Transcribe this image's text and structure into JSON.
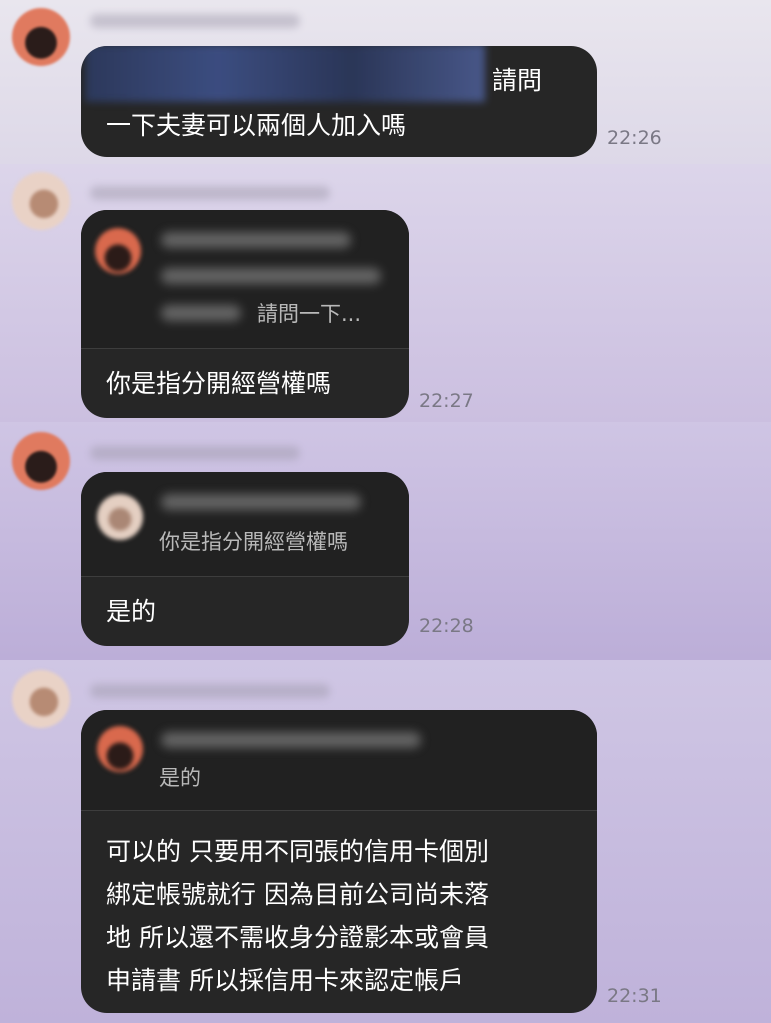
{
  "messages": [
    {
      "lines": [
        "請問",
        "一下夫妻可以兩個人加入嗎"
      ],
      "time": "22:26"
    },
    {
      "quote": "請問一下...",
      "lines": [
        "你是指分開經營權嗎"
      ],
      "time": "22:27"
    },
    {
      "quote": "你是指分開經營權嗎",
      "lines": [
        "是的"
      ],
      "time": "22:28"
    },
    {
      "quote": "是的",
      "lines": [
        "可以的 只要用不同張的信用卡個別",
        "綁定帳號就行 因為目前公司尚未落",
        "地 所以還不需收身分證影本或會員",
        "申請書 所以採信用卡來認定帳戶"
      ],
      "time": "22:31"
    }
  ],
  "icons": [
    "avatar",
    "quoted-avatar",
    "crown-icon"
  ]
}
